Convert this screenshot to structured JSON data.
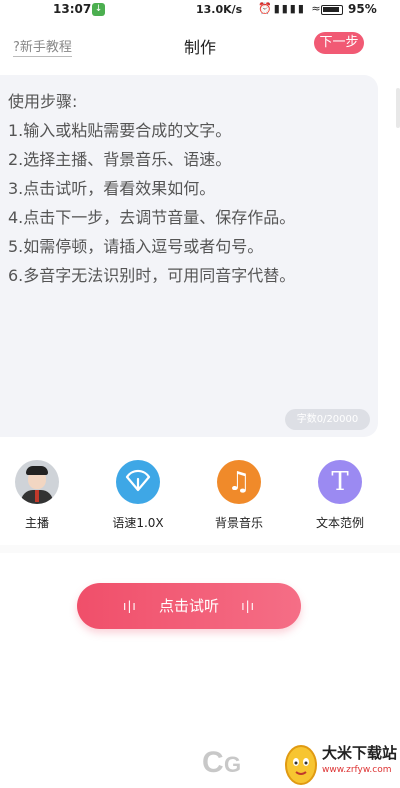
{
  "status_bar": {
    "time": "13:07",
    "speed": "13.0K/s",
    "battery": "95%",
    "battery_level": 0.95
  },
  "header": {
    "tutorial_label": "?新手教程",
    "title": "制作",
    "next_label": "下一步"
  },
  "editor": {
    "instructions": [
      "使用步骤:",
      "1.输入或粘贴需要合成的文字。",
      "2.选择主播、背景音乐、语速。",
      "3.点击试听，看看效果如何。",
      "4.点击下一步，去调节音量、保存作品。",
      "5.如需停顿，请插入逗号或者句号。",
      "6.多音字无法识别时，可用同音字代替。"
    ],
    "char_count": "字数0/20000"
  },
  "toolbar": {
    "anchor_label": "主播",
    "speed_label": "语速1.0X",
    "music_label": "背景音乐",
    "sample_label": "文本范例"
  },
  "play": {
    "label": "点击试听"
  },
  "watermark": {
    "site_name": "大米下载站",
    "url": "www.zrfyw.com",
    "logo_text": "CG西"
  },
  "colors": {
    "accent": "#f15a74",
    "speed_icon": "#3ea7e6",
    "music_icon": "#f08a2a",
    "text_icon": "#9b8af2"
  }
}
